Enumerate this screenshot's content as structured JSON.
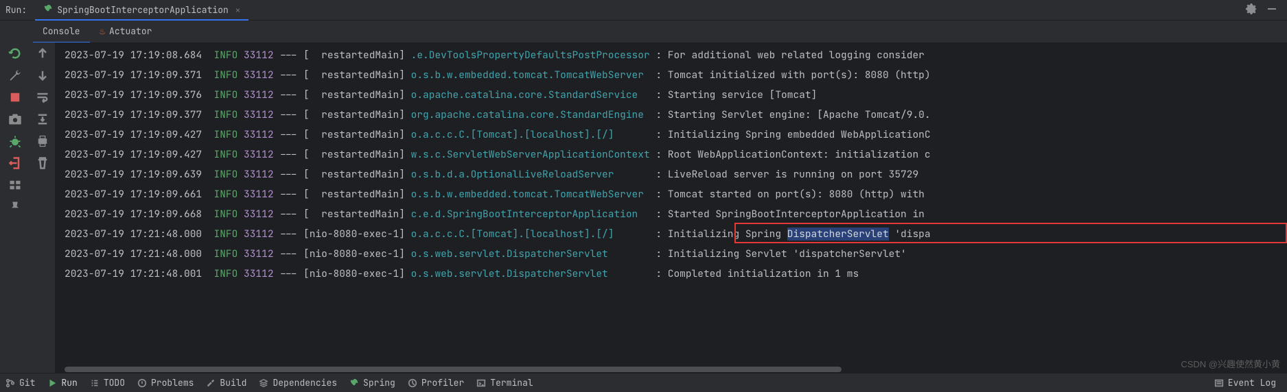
{
  "header": {
    "run_label": "Run:",
    "tab_title": "SpringBootInterceptorApplication"
  },
  "sub_tabs": {
    "console": "Console",
    "actuator": "Actuator"
  },
  "logs": [
    {
      "ts": "2023-07-19 17:19:08.684",
      "lvl": "INFO",
      "pid": "33112",
      "thr": "restartedMain",
      "cls": ".e.DevToolsPropertyDefaultsPostProcessor",
      "msg": "For additional web related logging consider"
    },
    {
      "ts": "2023-07-19 17:19:09.371",
      "lvl": "INFO",
      "pid": "33112",
      "thr": "restartedMain",
      "cls": "o.s.b.w.embedded.tomcat.TomcatWebServer",
      "msg": "Tomcat initialized with port(s): 8080 (http)"
    },
    {
      "ts": "2023-07-19 17:19:09.376",
      "lvl": "INFO",
      "pid": "33112",
      "thr": "restartedMain",
      "cls": "o.apache.catalina.core.StandardService",
      "msg": "Starting service [Tomcat]"
    },
    {
      "ts": "2023-07-19 17:19:09.377",
      "lvl": "INFO",
      "pid": "33112",
      "thr": "restartedMain",
      "cls": "org.apache.catalina.core.StandardEngine",
      "msg": "Starting Servlet engine: [Apache Tomcat/9.0."
    },
    {
      "ts": "2023-07-19 17:19:09.427",
      "lvl": "INFO",
      "pid": "33112",
      "thr": "restartedMain",
      "cls": "o.a.c.c.C.[Tomcat].[localhost].[/]",
      "msg": "Initializing Spring embedded WebApplicationC"
    },
    {
      "ts": "2023-07-19 17:19:09.427",
      "lvl": "INFO",
      "pid": "33112",
      "thr": "restartedMain",
      "cls": "w.s.c.ServletWebServerApplicationContext",
      "msg": "Root WebApplicationContext: initialization c"
    },
    {
      "ts": "2023-07-19 17:19:09.639",
      "lvl": "INFO",
      "pid": "33112",
      "thr": "restartedMain",
      "cls": "o.s.b.d.a.OptionalLiveReloadServer",
      "msg": "LiveReload server is running on port 35729"
    },
    {
      "ts": "2023-07-19 17:19:09.661",
      "lvl": "INFO",
      "pid": "33112",
      "thr": "restartedMain",
      "cls": "o.s.b.w.embedded.tomcat.TomcatWebServer",
      "msg": "Tomcat started on port(s): 8080 (http) with"
    },
    {
      "ts": "2023-07-19 17:19:09.668",
      "lvl": "INFO",
      "pid": "33112",
      "thr": "restartedMain",
      "cls": "c.e.d.SpringBootInterceptorApplication",
      "msg": "Started SpringBootInterceptorApplication in"
    },
    {
      "ts": "2023-07-19 17:21:48.000",
      "lvl": "INFO",
      "pid": "33112",
      "thr": "nio-8080-exec-1",
      "cls": "o.a.c.c.C.[Tomcat].[localhost].[/]",
      "msg_prefix": "Initializing Spring ",
      "msg_highlight": "DispatcherServlet",
      "msg_suffix": " 'dispa"
    },
    {
      "ts": "2023-07-19 17:21:48.000",
      "lvl": "INFO",
      "pid": "33112",
      "thr": "nio-8080-exec-1",
      "cls": "o.s.web.servlet.DispatcherServlet",
      "msg": "Initializing Servlet 'dispatcherServlet'"
    },
    {
      "ts": "2023-07-19 17:21:48.001",
      "lvl": "INFO",
      "pid": "33112",
      "thr": "nio-8080-exec-1",
      "cls": "o.s.web.servlet.DispatcherServlet",
      "msg": "Completed initialization in 1 ms"
    }
  ],
  "thread_alt": "nio-8080-exec-1",
  "footer": {
    "git": "Git",
    "run": "Run",
    "todo": "TODO",
    "problems": "Problems",
    "build": "Build",
    "dependencies": "Dependencies",
    "spring": "Spring",
    "profiler": "Profiler",
    "terminal": "Terminal",
    "event_log": "Event Log"
  },
  "watermark": "CSDN @兴趣使然黄小黄"
}
